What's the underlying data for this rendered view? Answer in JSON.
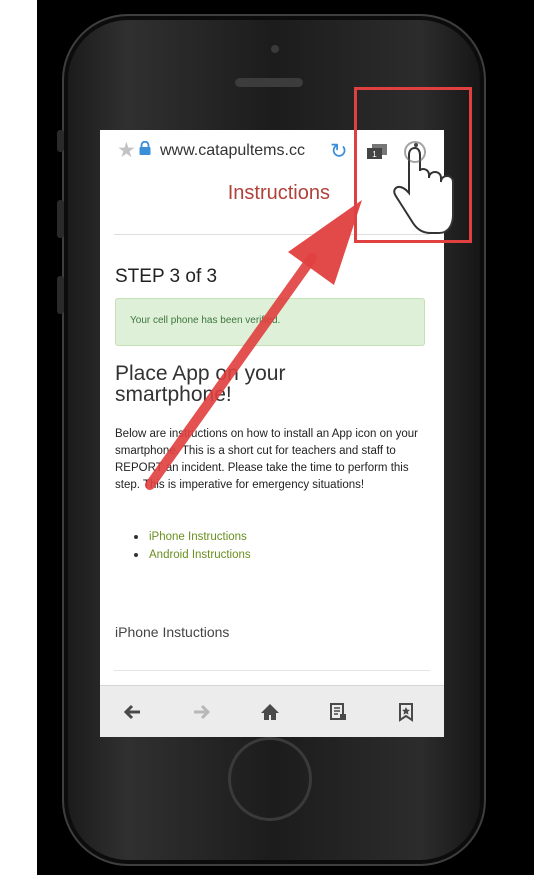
{
  "browser": {
    "url_text": "www.catapultems.cc",
    "icons": [
      "star-icon",
      "lock-icon",
      "reload-icon",
      "tabs-icon",
      "overflow-menu-icon"
    ]
  },
  "page": {
    "heading": "Instructions",
    "step_title": "STEP 3 of 3",
    "alert_text": "Your cell phone has been verified.",
    "section_title": "Place App on your smartphone!",
    "body_text": "Below are instructions on how to install an App icon on your smartphone. This is a short cut for teachers and staff to REPORT an incident. Please take the time to perform this step. This is imperative for emergency situations!",
    "links": [
      "iPhone Instructions",
      "Android Instructions"
    ],
    "sub_heading": "iPhone Instuctions"
  },
  "nav": {
    "icons": [
      "back-arrow-icon",
      "forward-arrow-icon",
      "home-icon",
      "reader-icon",
      "bookmark-icon"
    ]
  },
  "colors": {
    "heading_red": "#b0423a",
    "alert_bg": "#dff0d8",
    "alert_text": "#3c763d",
    "link_green": "#6a8f1e",
    "annotation_red": "#e0403f",
    "reload_blue": "#3a8fd8"
  }
}
